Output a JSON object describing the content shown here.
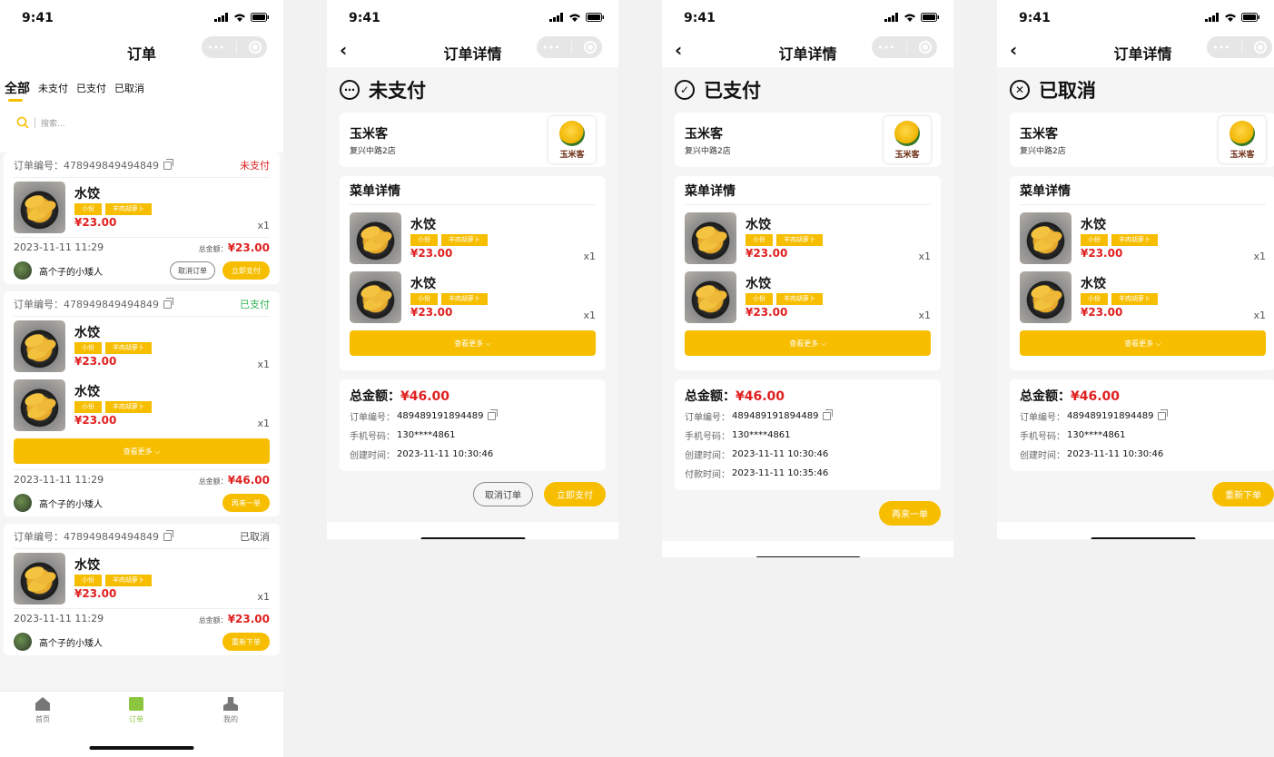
{
  "status_time": "9:41",
  "list_screen": {
    "title": "订单",
    "tabs": [
      "全部",
      "未支付",
      "已支付",
      "已取消"
    ],
    "search_placeholder": "搜索...",
    "orders": [
      {
        "no_label": "订单编号：478949849494849",
        "status": "未支付",
        "date": "2023-11-11  11:29",
        "total_label": "总金额：",
        "total": "¥23.00",
        "user": "高个子的小矮人",
        "btn1": "取消订单",
        "btn2": "立即支付"
      },
      {
        "no_label": "订单编号：478949849494849",
        "status": "已支付",
        "date": "2023-11-11  11:29",
        "total_label": "总金额：",
        "total": "¥46.00",
        "user": "高个子的小矮人",
        "btn2": "再来一单",
        "more": "查看更多 ⌵"
      },
      {
        "no_label": "订单编号：478949849494849",
        "status": "已取消",
        "date": "2023-11-11  11:29",
        "total_label": "总金额：",
        "total": "¥23.00",
        "user": "高个子的小矮人",
        "btn2": "重新下单"
      }
    ],
    "tabbar": [
      "首页",
      "订单",
      "我的"
    ]
  },
  "item": {
    "name": "水饺",
    "tag1": "小份",
    "tag2": "羊肉胡萝卜",
    "price": "¥23.00",
    "qty": "x1"
  },
  "detail": {
    "title": "订单详情",
    "shop_name": "玉米客",
    "shop_branch": "复兴中路2店",
    "logo_text": "玉米客",
    "menu_title": "菜单详情",
    "more": "查看更多 ⌵",
    "total_label": "总金额：",
    "total": "¥46.00",
    "order_label": "订单编号：",
    "order_no": "489489191894489",
    "phone_label": "手机号码：",
    "phone": "130****4861",
    "created_label": "创建时间：",
    "created": "2023-11-11  10:30:46",
    "paid_label": "付款时间：",
    "paid": "2023-11-11  10:35:46",
    "unpaid": {
      "status": "未支付",
      "btn1": "取消订单",
      "btn2": "立即支付"
    },
    "paid_screen": {
      "status": "已支付",
      "btn": "再来一单"
    },
    "cancel_screen": {
      "status": "已取消",
      "btn": "重新下单"
    }
  },
  "colors": {
    "accent": "#f7be00",
    "price": "#e02020",
    "paid": "#2fb350",
    "tab_active": "#8cc63e"
  }
}
